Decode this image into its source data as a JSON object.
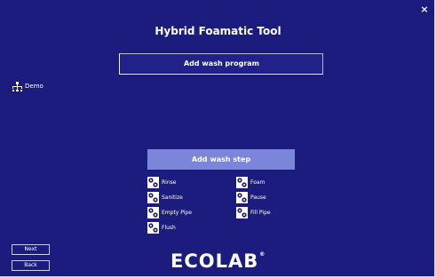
{
  "window": {
    "title": "Hybrid Foamatic Tool",
    "close_label": "×",
    "background_color": "#1c1c7e",
    "accent_color": "#7b86db"
  },
  "main": {
    "add_program_label": "Add wash program",
    "programs": [
      {
        "label": "Demo",
        "icon": "program-tree-icon"
      }
    ],
    "add_step_label": "Add wash step",
    "steps": [
      {
        "label": "Rinse",
        "icon": "step-gear-icon"
      },
      {
        "label": "Foam",
        "icon": "step-gear-icon"
      },
      {
        "label": "Sanitize",
        "icon": "step-gear-icon"
      },
      {
        "label": "Pause",
        "icon": "step-gear-icon"
      },
      {
        "label": "Empty Pipe",
        "icon": "step-gear-icon"
      },
      {
        "label": "Fill Pipe",
        "icon": "step-gear-icon"
      },
      {
        "label": "Flush",
        "icon": "step-gear-icon"
      }
    ]
  },
  "footer": {
    "next_label": "Next",
    "back_label": "Back",
    "logo_text": "ECOLAB",
    "logo_mark": "®"
  }
}
